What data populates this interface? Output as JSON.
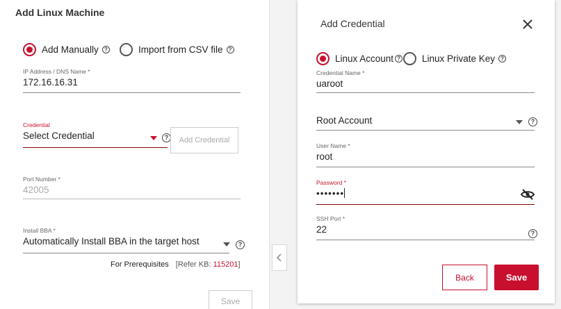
{
  "left": {
    "title": "Add Linux Machine",
    "options": [
      {
        "label": "Add Manually",
        "selected": true
      },
      {
        "label": "Import from CSV file",
        "selected": false
      }
    ],
    "ip": {
      "label": "IP Address / DNS Name *",
      "value": "172.16.16.31"
    },
    "credential": {
      "label": "Credential",
      "value": "Select Credential",
      "add_button": "Add Credential"
    },
    "port": {
      "label": "Port Number *",
      "value": "42005"
    },
    "bba": {
      "label": "Install BBA *",
      "value": "Automatically Install BBA in the target host"
    },
    "prereq": {
      "text": "For Prerequisites",
      "kb_prefix": "[Refer KB: ",
      "kb_number": "115201",
      "kb_suffix": "]"
    },
    "save_label": "Save"
  },
  "collapse_icon": "chevron-left-icon",
  "right": {
    "title": "Add Credential",
    "close_icon": "close-icon",
    "types": [
      {
        "label": "Linux Account",
        "selected": true
      },
      {
        "label": "Linux Private Key",
        "selected": false
      }
    ],
    "credential_name": {
      "label": "Credential Name *",
      "value": "uaroot"
    },
    "account_type": {
      "value": "Root Account"
    },
    "user_name": {
      "label": "User Name *",
      "value": "root"
    },
    "password": {
      "label": "Password *",
      "value": "•••••••",
      "toggle_icon": "eye-off-icon"
    },
    "ssh_port": {
      "label": "SSH Port *",
      "value": "22"
    },
    "back_label": "Back",
    "save_label": "Save"
  },
  "help_glyph": "?",
  "colors": {
    "accent": "#c8102e",
    "dark_red": "#8b0000"
  }
}
